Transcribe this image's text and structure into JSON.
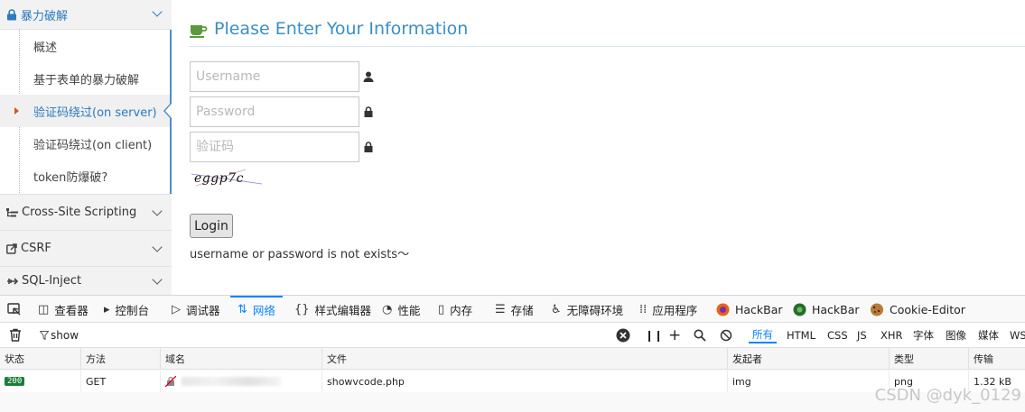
{
  "sidebar": {
    "header": {
      "label": "暴力破解",
      "icon": "lock-icon"
    },
    "items": [
      {
        "label": "概述"
      },
      {
        "label": "基于表单的暴力破解"
      },
      {
        "label": "验证码绕过(on server)",
        "active": true
      },
      {
        "label": "验证码绕过(on client)"
      },
      {
        "label": "token防爆破?"
      }
    ],
    "sections": [
      {
        "label": "Cross-Site Scripting",
        "icon": "hierarchy-icon"
      },
      {
        "label": "CSRF",
        "icon": "share-icon"
      },
      {
        "label": "SQL-Inject",
        "icon": "injection-icon"
      }
    ]
  },
  "main": {
    "title": "Please Enter Your Information",
    "username_placeholder": "Username",
    "password_placeholder": "Password",
    "captcha_placeholder": "验证码",
    "captcha_text": "eggp7c",
    "login_label": "Login",
    "error_message": "username or password is not exists～"
  },
  "devtools": {
    "tabs": [
      {
        "label": "查看器",
        "icon": "inspector-icon"
      },
      {
        "label": "控制台",
        "icon": "console-icon"
      },
      {
        "label": "调试器",
        "icon": "debugger-icon"
      },
      {
        "label": "网络",
        "icon": "network-icon",
        "active": true
      },
      {
        "label": "样式编辑器",
        "icon": "style-editor-icon"
      },
      {
        "label": "性能",
        "icon": "performance-icon"
      },
      {
        "label": "内存",
        "icon": "memory-icon"
      },
      {
        "label": "存储",
        "icon": "storage-icon"
      },
      {
        "label": "无障碍环境",
        "icon": "accessibility-icon"
      },
      {
        "label": "应用程序",
        "icon": "application-icon"
      },
      {
        "label": "HackBar",
        "icon": "firefox-icon"
      },
      {
        "label": "HackBar",
        "icon": "hackbar-icon"
      },
      {
        "label": "Cookie-Editor",
        "icon": "cookie-icon"
      }
    ],
    "filter_value": "show",
    "type_filters": [
      "所有",
      "HTML",
      "CSS",
      "JS",
      "XHR",
      "字体",
      "图像",
      "媒体",
      "WS"
    ],
    "active_type_filter": "所有",
    "columns": [
      "状态",
      "方法",
      "域名",
      "文件",
      "发起者",
      "类型",
      "传输"
    ],
    "rows": [
      {
        "status": "200",
        "method": "GET",
        "domain": "",
        "file": "showvcode.php",
        "initiator": "img",
        "type": "png",
        "transferred": "1.32 kB"
      }
    ]
  },
  "watermark": "CSDN @dyk_0129",
  "colors": {
    "accent": "#2a7ac0",
    "title": "#3a8fc5",
    "devtools_active": "#0a84ff",
    "status_ok": "#1a7e35"
  }
}
